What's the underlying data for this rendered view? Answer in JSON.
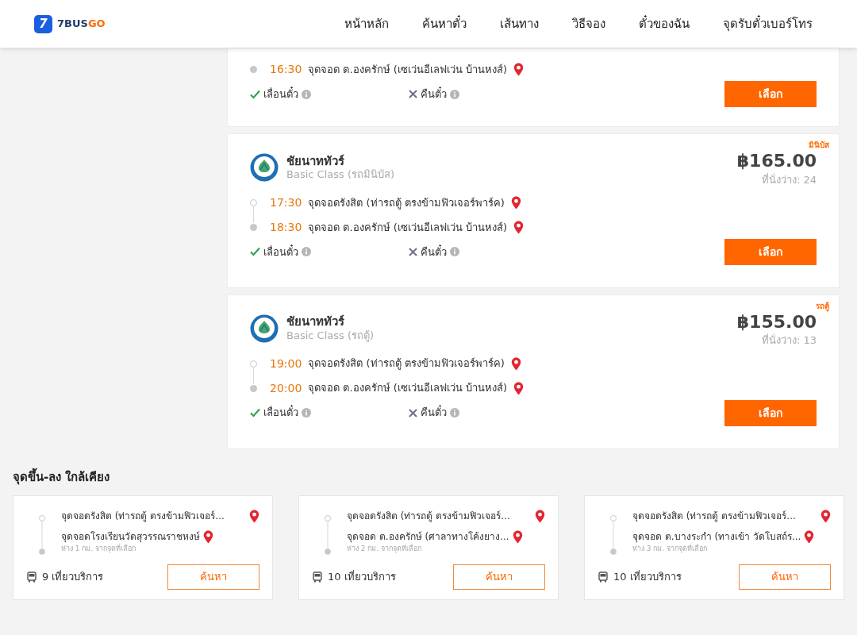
{
  "header": {
    "logo": {
      "mark": "7",
      "text": "7BUS",
      "accent": "GO"
    },
    "nav": [
      {
        "label": "หน้าหลัก"
      },
      {
        "label": "ค้นหาตั๋ว"
      },
      {
        "label": "เส้นทาง"
      },
      {
        "label": "วิธีจอง"
      },
      {
        "label": "ตั๋วของฉัน"
      },
      {
        "label": "จุดรับตั๋วเบอร์โทร"
      }
    ]
  },
  "trips": [
    {
      "partial": true,
      "stops": [
        {
          "time": "16:30",
          "place": "จุดจอด ต.องครักษ์ (เซเว่นอีเลฟเว่น บ้านหงส์)",
          "end": true
        }
      ],
      "features": [
        {
          "label": "เลื่อนตั๋ว",
          "allowed": true
        },
        {
          "label": "คืนตั๋ว",
          "allowed": false
        }
      ],
      "button": "เลือก"
    },
    {
      "partial": false,
      "tag": "มินิบัส",
      "operator": "ชัยนาททัวร์",
      "class": "Basic Class (รถมินิบัส)",
      "price": "฿165.00",
      "seats": "ที่นั่งว่าง: 24",
      "stops": [
        {
          "time": "17:30",
          "place": "จุดจอดรังสิต (ท่ารถตู้ ตรงข้ามฟิวเจอร์พาร์ค)",
          "end": false
        },
        {
          "time": "18:30",
          "place": "จุดจอด ต.องครักษ์ (เซเว่นอีเลฟเว่น บ้านหงส์)",
          "end": true
        }
      ],
      "features": [
        {
          "label": "เลื่อนตั๋ว",
          "allowed": true
        },
        {
          "label": "คืนตั๋ว",
          "allowed": false
        }
      ],
      "button": "เลือก"
    },
    {
      "partial": false,
      "tag": "รถตู้",
      "operator": "ชัยนาททัวร์",
      "class": "Basic Class (รถตู้)",
      "price": "฿155.00",
      "seats": "ที่นั่งว่าง: 13",
      "stops": [
        {
          "time": "19:00",
          "place": "จุดจอดรังสิต (ท่ารถตู้ ตรงข้ามฟิวเจอร์พาร์ค)",
          "end": false
        },
        {
          "time": "20:00",
          "place": "จุดจอด ต.องครักษ์ (เซเว่นอีเลฟเว่น บ้านหงส์)",
          "end": true
        }
      ],
      "features": [
        {
          "label": "เลื่อนตั๋ว",
          "allowed": true
        },
        {
          "label": "คืนตั๋ว",
          "allowed": false
        }
      ],
      "button": "เลือก"
    }
  ],
  "nearby": {
    "title": "จุดขึ้น-ลง ใกล้เคียง",
    "cards": [
      {
        "from": "จุดจอดรังสิต (ท่ารถตู้ ตรงข้ามฟิวเจอร์...",
        "to": "จุดจอดโรงเรียนวัดสุวรรณราชหงษ์",
        "distance": "ห่าง 1 กม. จากจุดที่เลือก",
        "trips": "9 เที่ยวบริการ",
        "button": "ค้นหา"
      },
      {
        "from": "จุดจอดรังสิต (ท่ารถตู้ ตรงข้ามฟิวเจอร์...",
        "to": "จุดจอด ต.องครักษ์ (ศาลาทางโค้งยาง...",
        "distance": "ห่าง 2 กม. จากจุดที่เลือก",
        "trips": "10 เที่ยวบริการ",
        "button": "ค้นหา"
      },
      {
        "from": "จุดจอดรังสิต (ท่ารถตู้ ตรงข้ามฟิวเจอร์...",
        "to": "จุดจอด ต.บางระกำ (ทางเข้า วัดโบสถ์ร...",
        "distance": "ห่าง 3 กม. จากจุดที่เลือก",
        "trips": "10 เที่ยวบริการ",
        "button": "ค้นหา"
      }
    ]
  }
}
